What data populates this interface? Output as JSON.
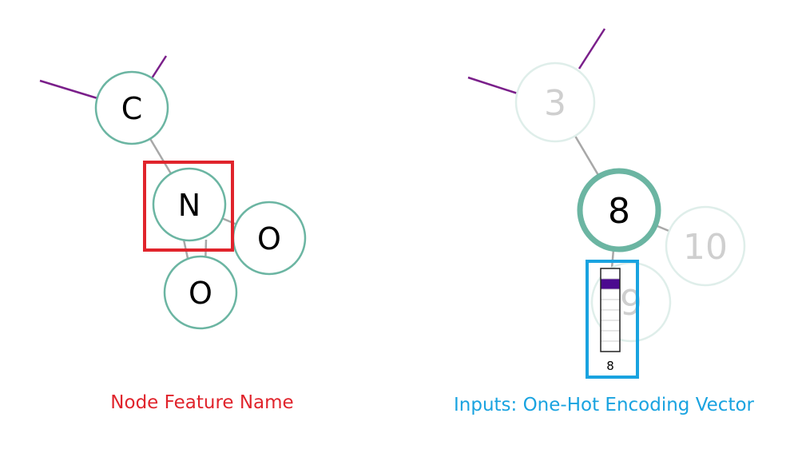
{
  "colors": {
    "node_stroke": "#6bb5a2",
    "node_stroke_faded": "#dfeeea",
    "edge_gray": "#a8a8a8",
    "edge_purple": "#7a1f8a",
    "highlight_red": "#e0242c",
    "highlight_blue": "#19a3e0",
    "onehot_fill": "#4b0a8f",
    "faded_text": "#cfcfcf"
  },
  "left_graph": {
    "nodes": [
      {
        "id": "c",
        "label": "C"
      },
      {
        "id": "n",
        "label": "N"
      },
      {
        "id": "o1",
        "label": "O"
      },
      {
        "id": "o2",
        "label": "O"
      }
    ],
    "caption": "Node Feature Name"
  },
  "right_graph": {
    "nodes": [
      {
        "id": "n3",
        "label": "3"
      },
      {
        "id": "n8",
        "label": "8"
      },
      {
        "id": "n10",
        "label": "10"
      },
      {
        "id": "n9",
        "label": "9"
      }
    ],
    "onehot": {
      "cells": 8,
      "active_index": 1,
      "label": "8"
    },
    "caption": "Inputs: One-Hot Encoding Vector"
  }
}
